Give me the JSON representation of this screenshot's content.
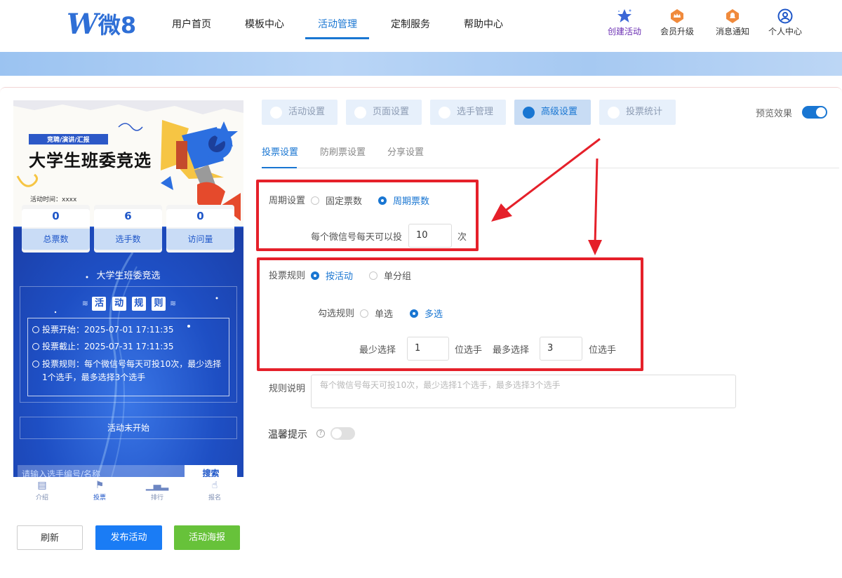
{
  "header": {
    "logo_text": "微8",
    "nav": [
      "用户首页",
      "模板中心",
      "活动管理",
      "定制服务",
      "帮助中心"
    ],
    "active_nav": "活动管理",
    "right_icons": [
      {
        "label": "创建活动",
        "icon": "star-icon"
      },
      {
        "label": "会员升级",
        "icon": "crown-badge-icon"
      },
      {
        "label": "消息通知",
        "icon": "bell-badge-icon"
      },
      {
        "label": "个人中心",
        "icon": "user-icon"
      }
    ]
  },
  "preview": {
    "poster_tag": "竞聘/演讲/汇报",
    "poster_title": "大学生班委竞选",
    "poster_time": "活动时间：xxxx",
    "stats": [
      {
        "value": "0",
        "label": "总票数"
      },
      {
        "value": "6",
        "label": "选手数"
      },
      {
        "value": "0",
        "label": "访问量"
      }
    ],
    "event_name": "大学生班委竞选",
    "rules_heading": [
      "活",
      "动",
      "规",
      "则"
    ],
    "rules": [
      "投票开始：2025-07-01 17:11:35",
      "投票截止：2025-07-31 17:11:35",
      "投票规则：每个微信号每天可投10次，最少选择1个选手，最多选择3个选手"
    ],
    "status": "活动未开始",
    "search_placeholder": "请输入选手编号/名称",
    "search_button": "搜索",
    "tabs": [
      {
        "label": "介绍",
        "icon": "document-icon"
      },
      {
        "label": "投票",
        "icon": "flag-icon"
      },
      {
        "label": "排行",
        "icon": "bar-chart-icon"
      },
      {
        "label": "报名",
        "icon": "hand-pointer-icon"
      }
    ],
    "active_tab": "投票"
  },
  "actions": {
    "refresh": "刷新",
    "publish": "发布活动",
    "poster": "活动海报"
  },
  "steps": [
    {
      "label": "活动设置",
      "icon": "shield-icon"
    },
    {
      "label": "页面设置",
      "icon": "page-icon"
    },
    {
      "label": "选手管理",
      "icon": "user-icon"
    },
    {
      "label": "高级设置",
      "icon": "sliders-icon"
    },
    {
      "label": "投票统计",
      "icon": "chart-icon"
    }
  ],
  "active_step": "高级设置",
  "preview_toggle_label": "预览效果",
  "subtabs": [
    "投票设置",
    "防刷票设置",
    "分享设置"
  ],
  "active_subtab": "投票设置",
  "form": {
    "period_label": "周期设置",
    "period_options": [
      "固定票数",
      "周期票数"
    ],
    "period_selected": "周期票数",
    "per_day_label": "每个微信号每天可以投",
    "per_day_value": "10",
    "per_day_unit": "次",
    "vote_rule_label": "投票规则",
    "vote_rule_options": [
      "按活动",
      "单分组"
    ],
    "vote_rule_selected": "按活动",
    "check_rule_label": "勾选规则",
    "check_rule_options": [
      "单选",
      "多选"
    ],
    "check_rule_selected": "多选",
    "min_label": "最少选择",
    "min_value": "1",
    "min_unit": "位选手",
    "max_label": "最多选择",
    "max_value": "3",
    "max_unit": "位选手",
    "desc_label": "规则说明",
    "desc_placeholder": "每个微信号每天可投10次，最少选择1个选手，最多选择3个选手",
    "warm_label": "温馨提示",
    "warm_enabled": false
  },
  "colors": {
    "primary": "#1976d2",
    "annotation": "#e5202a",
    "publish": "#1a7cf5",
    "poster": "#67c23a"
  }
}
